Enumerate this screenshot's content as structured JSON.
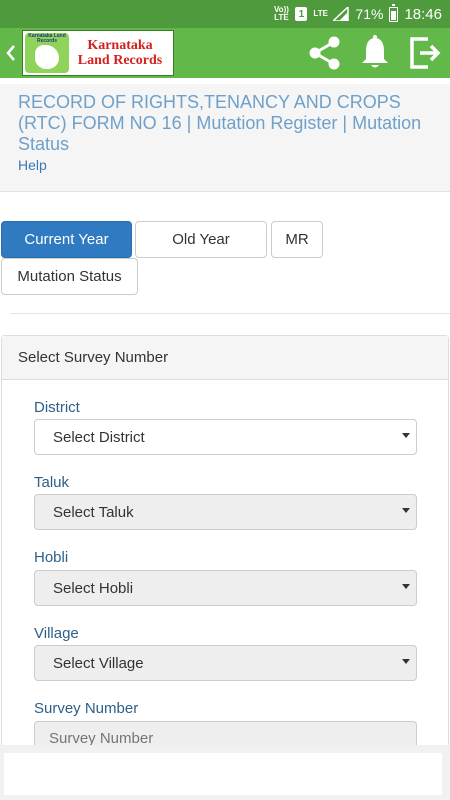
{
  "status_bar": {
    "volte": "Vo)) LTE",
    "sim": "1",
    "network": "LTE",
    "battery": "71%",
    "time": "18:46"
  },
  "app_bar": {
    "logo": {
      "seal_text": "Karnataka Land Records",
      "title_line1": "Karnataka",
      "title_line2": "Land Records"
    },
    "icons": [
      "back-icon",
      "share-icon",
      "bell-icon",
      "exit-icon"
    ],
    "color": "#62b849"
  },
  "header": {
    "title": "RECORD OF RIGHTS,TENANCY AND CROPS (RTC) FORM NO 16 | Mutation Register | Mutation Status",
    "help": "Help"
  },
  "tabs": [
    {
      "label": "Current Year",
      "active": true
    },
    {
      "label": "Old Year",
      "active": false
    },
    {
      "label": "MR",
      "active": false
    },
    {
      "label": "Mutation Status",
      "active": false
    }
  ],
  "panel": {
    "heading": "Select Survey Number",
    "fields": {
      "district": {
        "label": "District",
        "value": "Select District"
      },
      "taluk": {
        "label": "Taluk",
        "value": "Select Taluk"
      },
      "hobli": {
        "label": "Hobli",
        "value": "Select Hobli"
      },
      "village": {
        "label": "Village",
        "value": "Select Village"
      },
      "survey_number": {
        "label": "Survey Number",
        "placeholder": "Survey Number"
      }
    }
  },
  "colors": {
    "accent": "#2f7ac1",
    "status_bar": "#4f9a3c"
  }
}
